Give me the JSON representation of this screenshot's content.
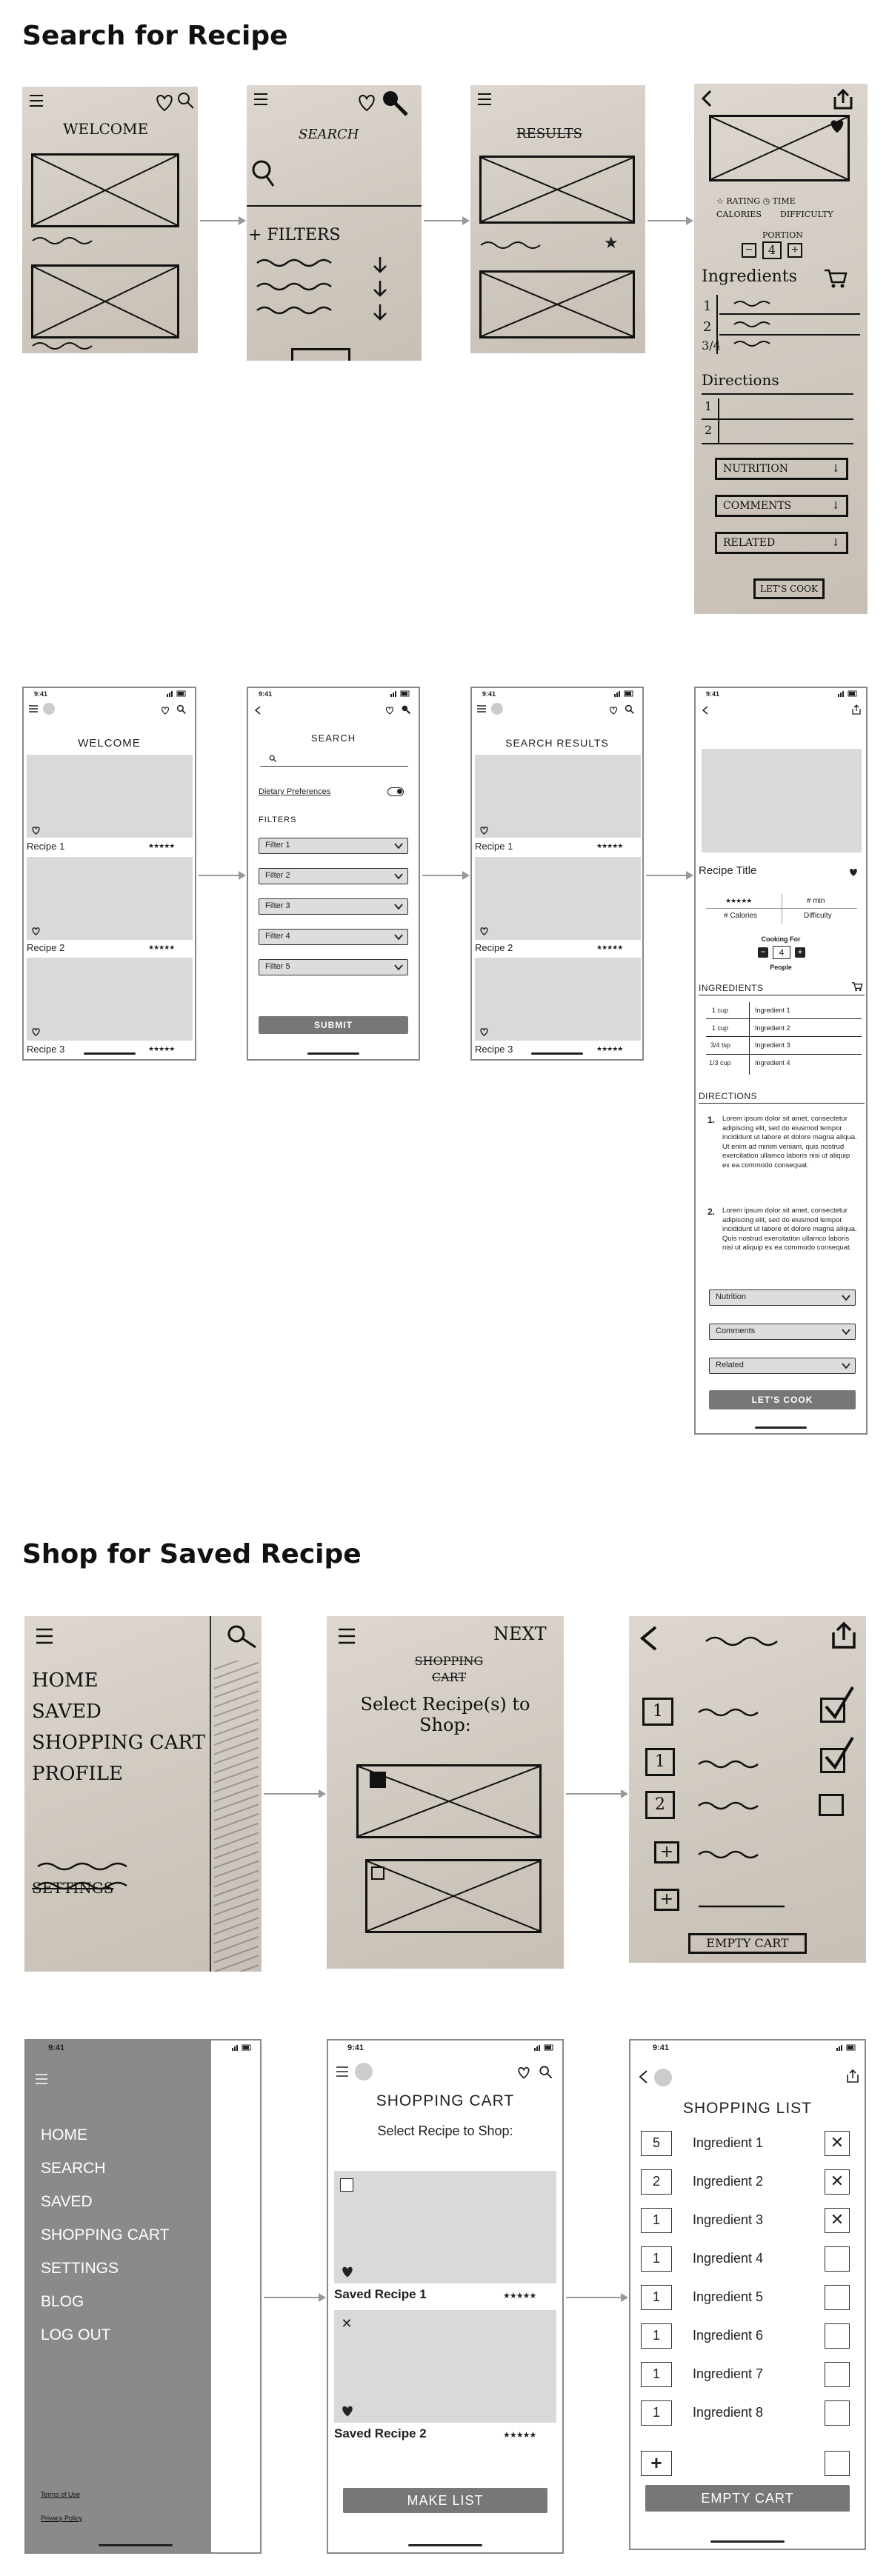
{
  "sections": {
    "search": "Search for Recipe",
    "shop": "Shop for Saved Recipe"
  },
  "sketch1": {
    "welcome": "WELCOME",
    "search": "SEARCH",
    "filters": "+ FILTERS",
    "results": "RESULTS",
    "detail": {
      "rating": "RATING",
      "time": "TIME",
      "calories": "CALORIES",
      "difficulty": "DIFFICULTY",
      "portion": "PORTION",
      "portion_value": "4",
      "ingredients": "Ingredients",
      "rows": [
        "1",
        "2",
        "3/4"
      ],
      "directions": "Directions",
      "steps": [
        "1",
        "2"
      ],
      "nutrition": "NUTRITION",
      "comments": "COMMENTS",
      "related": "RELATED",
      "lets_cook": "LET'S COOK"
    }
  },
  "status_time": "9:41",
  "wire1": {
    "welcome": {
      "title": "WELCOME",
      "recipes": [
        "Recipe 1",
        "Recipe 2",
        "Recipe 3"
      ]
    },
    "search": {
      "title": "SEARCH",
      "dietary": "Dietary Preferences",
      "filters_label": "FILTERS",
      "filters": [
        "Filter 1",
        "Filter 2",
        "Filter 3",
        "Filter 4",
        "Filter 5"
      ],
      "submit": "SUBMIT"
    },
    "results": {
      "title": "SEARCH RESULTS",
      "recipes": [
        "Recipe 1",
        "Recipe 2",
        "Recipe 3"
      ]
    },
    "detail": {
      "title": "Recipe Title",
      "time": "# min",
      "calories": "# Calories",
      "difficulty": "Difficulty",
      "cooking_for": "Cooking For",
      "people_count": "4",
      "people": "People",
      "ingredients_heading": "INGREDIENTS",
      "ingredients": [
        {
          "qty": "1 cup",
          "name": "Ingredient 1"
        },
        {
          "qty": "1 cup",
          "name": "Ingredient 2"
        },
        {
          "qty": "3/4 tsp",
          "name": "Ingredient 3"
        },
        {
          "qty": "1/3 cup",
          "name": "Ingredient 4"
        }
      ],
      "directions_heading": "DIRECTIONS",
      "steps": [
        {
          "num": "1.",
          "text": "Lorem ipsum dolor sit amet, consectetur adipiscing elit, sed do eiusmod tempor incididunt ut labore et dolore magna aliqua. Ut enim ad minim veniam, quis nostrud exercitation ullamco laboris nisi ut aliquip ex ea commodo consequat."
        },
        {
          "num": "2.",
          "text": "Lorem ipsum dolor sit amet, consectetur adipiscing elit, sed do eiusmod tempor incididunt ut labore et dolore magna aliqua. Quis nostrud exercitation ullamco laboris nisi ut aliquip ex ea commodo consequat."
        }
      ],
      "nutrition": "Nutrition",
      "comments": "Comments",
      "related": "Related",
      "lets_cook": "LET'S COOK"
    }
  },
  "sketch2": {
    "menu": [
      "HOME",
      "SAVED",
      "SHOPPING CART",
      "PROFILE"
    ],
    "settings": "SETTINGS",
    "next": "NEXT",
    "shopping_cart": "SHOPPING CART",
    "select": "Select Recipe(s) to Shop:",
    "list_qty": [
      "1",
      "1",
      "2",
      "+",
      "+"
    ],
    "empty_cart": "EMPTY CART"
  },
  "wire2": {
    "menu": {
      "items": [
        "HOME",
        "SEARCH",
        "SAVED",
        "SHOPPING CART",
        "SETTINGS",
        "BLOG",
        "LOG OUT"
      ],
      "terms": "Terms of Use",
      "privacy": "Privacy Policy"
    },
    "cart": {
      "title": "SHOPPING CART",
      "subtitle": "Select Recipe to Shop:",
      "recipes": [
        "Saved Recipe 1",
        "Saved Recipe 2"
      ],
      "make_list": "MAKE LIST"
    },
    "list": {
      "title": "SHOPPING LIST",
      "items": [
        {
          "qty": "5",
          "name": "Ingredient 1",
          "mark": "✕"
        },
        {
          "qty": "2",
          "name": "Ingredient 2",
          "mark": "✕"
        },
        {
          "qty": "1",
          "name": "Ingredient 3",
          "mark": "✕"
        },
        {
          "qty": "1",
          "name": "Ingredient 4",
          "mark": ""
        },
        {
          "qty": "1",
          "name": "Ingredient 5",
          "mark": ""
        },
        {
          "qty": "1",
          "name": "Ingredient 6",
          "mark": ""
        },
        {
          "qty": "1",
          "name": "Ingredient 7",
          "mark": ""
        },
        {
          "qty": "1",
          "name": "Ingredient 8",
          "mark": ""
        }
      ],
      "add": "+",
      "empty_cart": "EMPTY CART"
    }
  },
  "stars": "★★★★★",
  "icons": {
    "menu": "hamburger-icon",
    "heart": "heart-icon",
    "search": "search-icon",
    "back": "back-icon",
    "share": "share-icon",
    "cart": "cart-icon"
  }
}
